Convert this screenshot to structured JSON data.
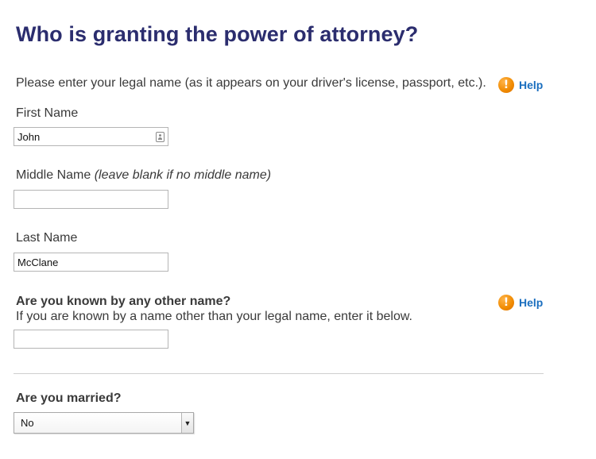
{
  "page": {
    "title": "Who is granting the power of attorney?",
    "intro": "Please enter your legal name (as it appears on your driver's license, passport, etc.).",
    "help_label": "Help"
  },
  "fields": {
    "first_name": {
      "label": "First Name",
      "value": "John"
    },
    "middle_name": {
      "label": "Middle Name",
      "hint": "(leave blank if no middle name)",
      "value": ""
    },
    "last_name": {
      "label": "Last Name",
      "value": "McClane"
    }
  },
  "other_name": {
    "question": "Are you known by any other name?",
    "instruction": "If you are known by a name other than your legal name, enter it below.",
    "value": "",
    "help_label": "Help"
  },
  "married": {
    "question": "Are you married?",
    "selected": "No"
  },
  "icons": {
    "help": "help-exclamation-icon",
    "contact_card": "contact-card-icon",
    "dropdown": "dropdown-arrow-icon"
  },
  "colors": {
    "title": "#2b2d6e",
    "help_link": "#1b6fbf",
    "help_icon": "#f08a00"
  }
}
